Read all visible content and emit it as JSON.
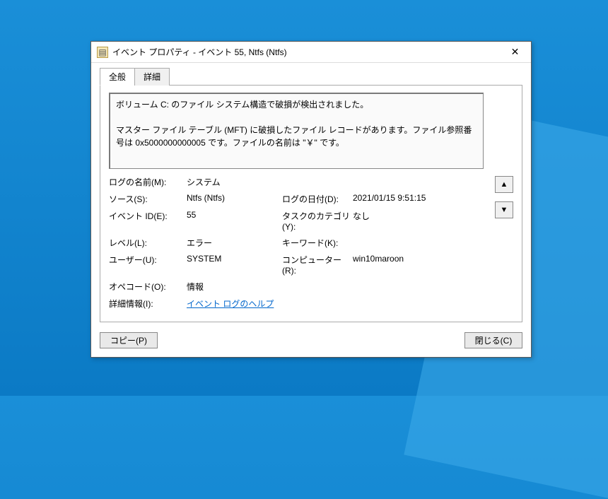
{
  "window": {
    "title": "イベント プロパティ - イベント 55, Ntfs (Ntfs)"
  },
  "tabs": {
    "general": "全般",
    "details": "詳細"
  },
  "description": {
    "line1": "ボリューム C: のファイル システム構造で破損が検出されました。",
    "line2": "マスター ファイル テーブル (MFT) に破損したファイル レコードがあります。ファイル参照番号は 0x5000000000005 です。ファイルの名前は \"￥\" です。"
  },
  "fields": {
    "log_name_label": "ログの名前(M):",
    "log_name_value": "システム",
    "source_label": "ソース(S):",
    "source_value": "Ntfs (Ntfs)",
    "logged_label": "ログの日付(D):",
    "logged_value": "2021/01/15 9:51:15",
    "event_id_label": "イベント ID(E):",
    "event_id_value": "55",
    "category_label": "タスクのカテゴリ(Y):",
    "category_value": "なし",
    "level_label": "レベル(L):",
    "level_value": "エラー",
    "keywords_label": "キーワード(K):",
    "keywords_value": "",
    "user_label": "ユーザー(U):",
    "user_value": "SYSTEM",
    "computer_label": "コンピューター(R):",
    "computer_value": "win10maroon",
    "opcode_label": "オペコード(O):",
    "opcode_value": "情報",
    "moreinfo_label": "詳細情報(I):",
    "moreinfo_link": "イベント ログのヘルプ"
  },
  "buttons": {
    "copy": "コピー(P)",
    "close": "閉じる(C)"
  }
}
